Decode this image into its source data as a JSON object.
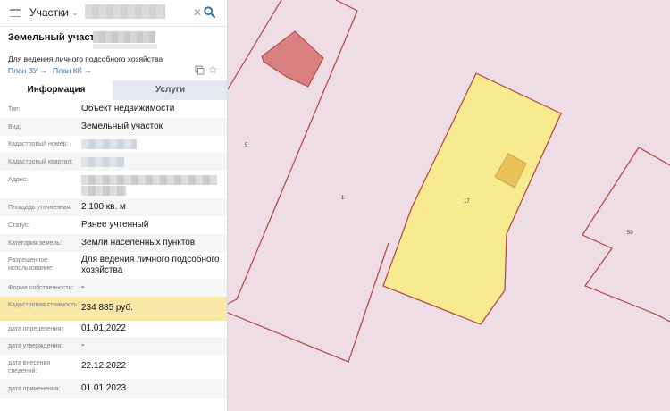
{
  "search": {
    "layer": "Участки"
  },
  "object": {
    "title": "Земельный участок",
    "subtitle": "Для ведения личного подсобного хозяйства",
    "link_zu": "План ЗУ →",
    "link_kk": "План КК →"
  },
  "tabs": {
    "info": "Информация",
    "services": "Услуги"
  },
  "rows": [
    {
      "label": "Тип:",
      "value": "Объект недвижимости"
    },
    {
      "label": "Вид:",
      "value": "Земельный участок"
    },
    {
      "label": "Кадастровый номер:",
      "value": ""
    },
    {
      "label": "Кадастровый квартал:",
      "value": ""
    },
    {
      "label": "Адрес:",
      "value": ""
    },
    {
      "label": "Площадь уточненная:",
      "value": "2 100 кв. м"
    },
    {
      "label": "Статус:",
      "value": "Ранее учтенный"
    },
    {
      "label": "Категория земель:",
      "value": "Земли населённых пунктов"
    },
    {
      "label": "Разрешенное использование:",
      "value": "Для ведения личного подсобного хозяйства"
    },
    {
      "label": "Форма собственности:",
      "value": "-"
    },
    {
      "label": "Кадастровая стоимость:",
      "value": "234 885 руб."
    },
    {
      "label": "дата определения:",
      "value": "01.01.2022"
    },
    {
      "label": "дата утверждения:",
      "value": "-"
    },
    {
      "label": "дата внесения сведений:",
      "value": "22.12.2022"
    },
    {
      "label": "дата применения:",
      "value": "01.01.2023"
    }
  ],
  "map": {
    "parcel_labels": [
      "5",
      "1",
      "17",
      "59"
    ],
    "colors": {
      "background": "#efdde6",
      "boundary": "#b5413c",
      "selected_fill": "#f8ea8f",
      "building_fill": "#d98080",
      "building_selected_fill": "#e8c35a"
    }
  },
  "colors": {
    "link": "#2b6cb0",
    "highlight_row": "#f8e7a7",
    "search_icon": "#2b6cb0"
  }
}
